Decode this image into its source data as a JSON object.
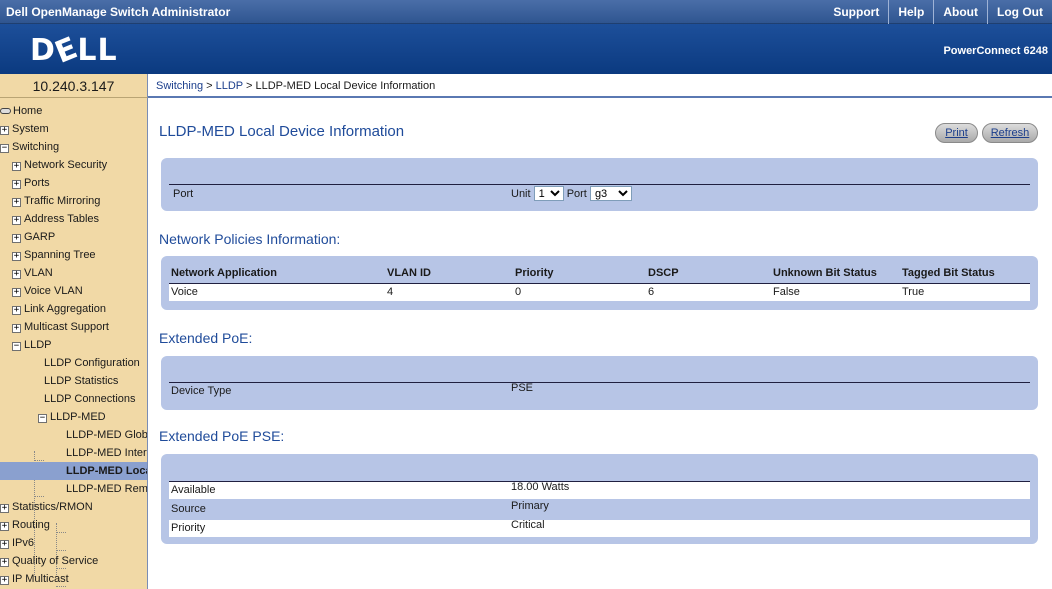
{
  "topbar": {
    "title": "Dell OpenManage Switch Administrator",
    "links": [
      "Support",
      "Help",
      "About",
      "Log Out"
    ]
  },
  "brand": {
    "logo": "DELL",
    "model": "PowerConnect 6248"
  },
  "ip": "10.240.3.147",
  "breadcrumb": {
    "switching": "Switching",
    "sep1": " > ",
    "lldp": "LLDP",
    "current": " > LLDP-MED Local Device Information"
  },
  "sidebar": {
    "items": [
      {
        "label": "Home"
      },
      {
        "label": "System"
      },
      {
        "label": "Switching"
      },
      {
        "label": "Network Security"
      },
      {
        "label": "Ports"
      },
      {
        "label": "Traffic Mirroring"
      },
      {
        "label": "Address Tables"
      },
      {
        "label": "GARP"
      },
      {
        "label": "Spanning Tree"
      },
      {
        "label": "VLAN"
      },
      {
        "label": "Voice VLAN"
      },
      {
        "label": "Link Aggregation"
      },
      {
        "label": "Multicast Support"
      },
      {
        "label": "LLDP"
      },
      {
        "label": "LLDP Configuration"
      },
      {
        "label": "LLDP Statistics"
      },
      {
        "label": "LLDP Connections"
      },
      {
        "label": "LLDP-MED"
      },
      {
        "label": "LLDP-MED Glob"
      },
      {
        "label": "LLDP-MED Interf"
      },
      {
        "label": "LLDP-MED Loca"
      },
      {
        "label": "LLDP-MED Rem"
      },
      {
        "label": "Statistics/RMON"
      },
      {
        "label": "Routing"
      },
      {
        "label": "IPv6"
      },
      {
        "label": "Quality of Service"
      },
      {
        "label": "IP Multicast"
      }
    ]
  },
  "page": {
    "title": "LLDP-MED Local Device Information",
    "print": "Print",
    "refresh": "Refresh"
  },
  "port": {
    "label": "Port",
    "unit_label": "Unit",
    "unit_value": "1",
    "port_label": "Port",
    "port_value": "g3"
  },
  "network_policies": {
    "title": "Network Policies Information:",
    "headers": [
      "Network Application",
      "VLAN ID",
      "Priority",
      "DSCP",
      "Unknown Bit Status",
      "Tagged Bit Status"
    ],
    "rows": [
      [
        "Voice",
        "4",
        "0",
        "6",
        "False",
        "True"
      ]
    ]
  },
  "extended_poe": {
    "title": "Extended PoE:",
    "device_type_label": "Device Type",
    "device_type_value": "PSE"
  },
  "extended_poe_pse": {
    "title": "Extended PoE PSE:",
    "rows": [
      {
        "label": "Available",
        "value": "18.00  Watts"
      },
      {
        "label": "Source",
        "value": "Primary"
      },
      {
        "label": "Priority",
        "value": "Critical"
      }
    ]
  },
  "colors": {
    "accent": "#1f4b9a",
    "sidebar_bg": "#f1d9a6",
    "panel_bg": "#b7c5e6",
    "selected": "#8aa0cf"
  }
}
